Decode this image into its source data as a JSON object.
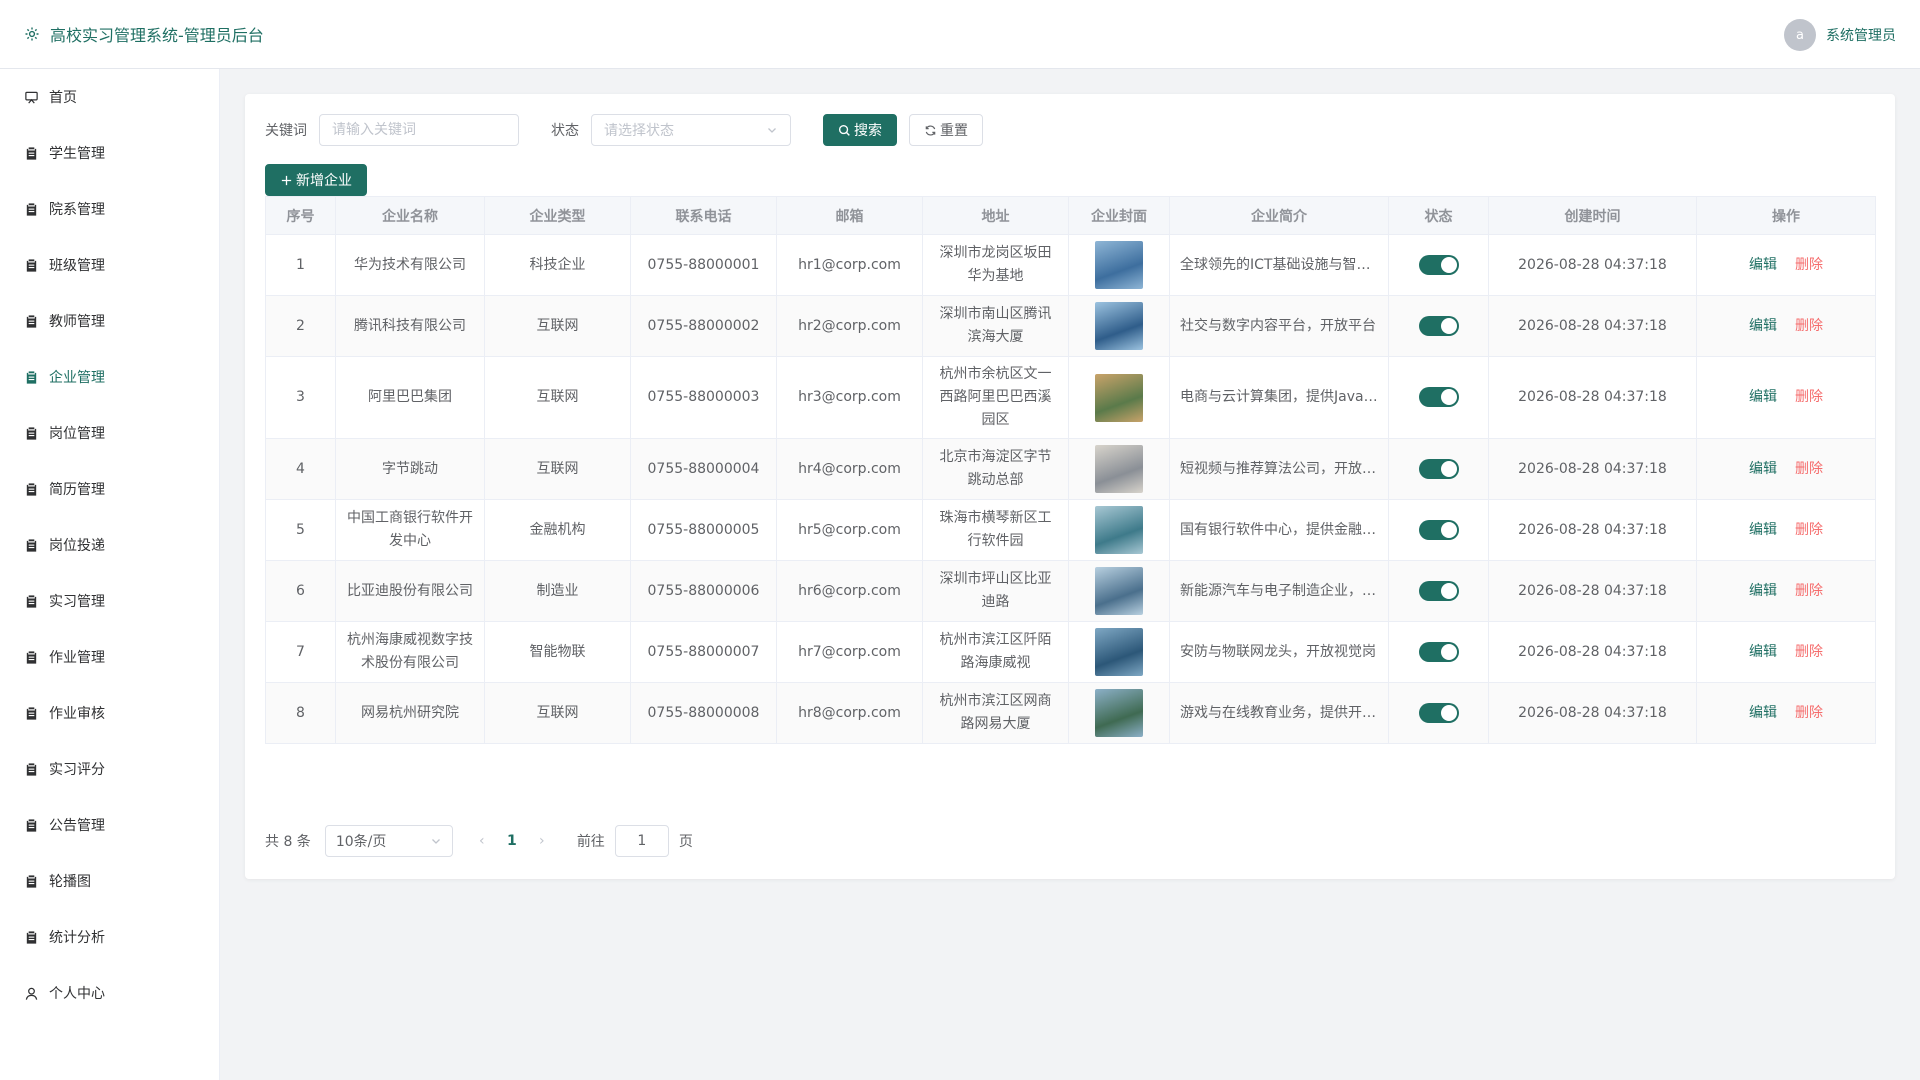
{
  "header": {
    "app_title": "高校实习管理系统-管理员后台",
    "avatar_letter": "a",
    "user_name": "系统管理员"
  },
  "sidebar": {
    "items": [
      {
        "label": "首页",
        "icon": "dashboard-icon",
        "active": false
      },
      {
        "label": "学生管理",
        "icon": "clipboard-icon",
        "active": false
      },
      {
        "label": "院系管理",
        "icon": "clipboard-icon",
        "active": false
      },
      {
        "label": "班级管理",
        "icon": "clipboard-icon",
        "active": false
      },
      {
        "label": "教师管理",
        "icon": "clipboard-icon",
        "active": false
      },
      {
        "label": "企业管理",
        "icon": "clipboard-icon",
        "active": true
      },
      {
        "label": "岗位管理",
        "icon": "clipboard-icon",
        "active": false
      },
      {
        "label": "简历管理",
        "icon": "clipboard-icon",
        "active": false
      },
      {
        "label": "岗位投递",
        "icon": "clipboard-icon",
        "active": false
      },
      {
        "label": "实习管理",
        "icon": "clipboard-icon",
        "active": false
      },
      {
        "label": "作业管理",
        "icon": "clipboard-icon",
        "active": false
      },
      {
        "label": "作业审核",
        "icon": "clipboard-icon",
        "active": false
      },
      {
        "label": "实习评分",
        "icon": "clipboard-icon",
        "active": false
      },
      {
        "label": "公告管理",
        "icon": "clipboard-icon",
        "active": false
      },
      {
        "label": "轮播图",
        "icon": "clipboard-icon",
        "active": false
      },
      {
        "label": "统计分析",
        "icon": "clipboard-icon",
        "active": false
      },
      {
        "label": "个人中心",
        "icon": "user-icon",
        "active": false
      }
    ]
  },
  "filters": {
    "keyword_label": "关键词",
    "keyword_value": "",
    "keyword_placeholder": "请输入关键词",
    "status_label": "状态",
    "status_placeholder": "请选择状态",
    "search_label": "搜索",
    "reset_label": "重置"
  },
  "toolbar": {
    "add_label": "新增企业"
  },
  "table": {
    "columns": [
      "序号",
      "企业名称",
      "企业类型",
      "联系电话",
      "邮箱",
      "地址",
      "企业封面",
      "企业简介",
      "状态",
      "创建时间",
      "操作"
    ],
    "edit_label": "编辑",
    "delete_label": "删除",
    "rows": [
      {
        "index": "1",
        "name": "华为技术有限公司",
        "type": "科技企业",
        "phone": "0755-88000001",
        "email": "hr1@corp.com",
        "address": "深圳市龙岗区坂田华为基地",
        "intro": "全球领先的ICT基础设施与智能终端提供商",
        "status_on": true,
        "created": "2026-08-28 04:37:18",
        "cover_colors": [
          "#3d6e9e",
          "#8fb6d6"
        ]
      },
      {
        "index": "2",
        "name": "腾讯科技有限公司",
        "type": "互联网",
        "phone": "0755-88000002",
        "email": "hr2@corp.com",
        "address": "深圳市南山区腾讯滨海大厦",
        "intro": "社交与数字内容平台，开放平台",
        "status_on": true,
        "created": "2026-08-28 04:37:18",
        "cover_colors": [
          "#2f5d8a",
          "#9cc3e0"
        ]
      },
      {
        "index": "3",
        "name": "阿里巴巴集团",
        "type": "互联网",
        "phone": "0755-88000003",
        "email": "hr3@corp.com",
        "address": "杭州市余杭区文一西路阿里巴巴西溪园区",
        "intro": "电商与云计算集团，提供Java岗位",
        "status_on": true,
        "created": "2026-08-28 04:37:18",
        "cover_colors": [
          "#5a7a4a",
          "#c9a36a"
        ]
      },
      {
        "index": "4",
        "name": "字节跳动",
        "type": "互联网",
        "phone": "0755-88000004",
        "email": "hr4@corp.com",
        "address": "北京市海淀区字节跳动总部",
        "intro": "短视频与推荐算法公司，开放算法岗",
        "status_on": true,
        "created": "2026-08-28 04:37:18",
        "cover_colors": [
          "#8a8f96",
          "#d8d4cc"
        ]
      },
      {
        "index": "5",
        "name": "中国工商银行软件开发中心",
        "type": "金融机构",
        "phone": "0755-88000005",
        "email": "hr5@corp.com",
        "address": "珠海市横琴新区工行软件园",
        "intro": "国有银行软件中心，提供金融科技岗",
        "status_on": true,
        "created": "2026-08-28 04:37:18",
        "cover_colors": [
          "#3e7a8a",
          "#a8c8d4"
        ]
      },
      {
        "index": "6",
        "name": "比亚迪股份有限公司",
        "type": "制造业",
        "phone": "0755-88000006",
        "email": "hr6@corp.com",
        "address": "深圳市坪山区比亚迪路",
        "intro": "新能源汽车与电子制造企业，开放工程岗",
        "status_on": true,
        "created": "2026-08-28 04:37:18",
        "cover_colors": [
          "#4a6f8c",
          "#b8d0e0"
        ]
      },
      {
        "index": "7",
        "name": "杭州海康威视数字技术股份有限公司",
        "type": "智能物联",
        "phone": "0755-88000007",
        "email": "hr7@corp.com",
        "address": "杭州市滨江区阡陌路海康威视",
        "intro": "安防与物联网龙头，开放视觉岗",
        "status_on": true,
        "created": "2026-08-28 04:37:18",
        "cover_colors": [
          "#2c5778",
          "#7fa8c4"
        ]
      },
      {
        "index": "8",
        "name": "网易杭州研究院",
        "type": "互联网",
        "phone": "0755-88000008",
        "email": "hr8@corp.com",
        "address": "杭州市滨江区网商路网易大厦",
        "intro": "游戏与在线教育业务，提供开发岗",
        "status_on": true,
        "created": "2026-08-28 04:37:18",
        "cover_colors": [
          "#3f6a52",
          "#8cb0c8"
        ]
      }
    ]
  },
  "pagination": {
    "total_text": "共 8 条",
    "page_size": "10条/页",
    "current_page": "1",
    "goto_label": "前往",
    "goto_value": "1",
    "page_suffix": "页"
  },
  "colors": {
    "accent": "#1f6f63",
    "danger": "#f56c6c"
  }
}
